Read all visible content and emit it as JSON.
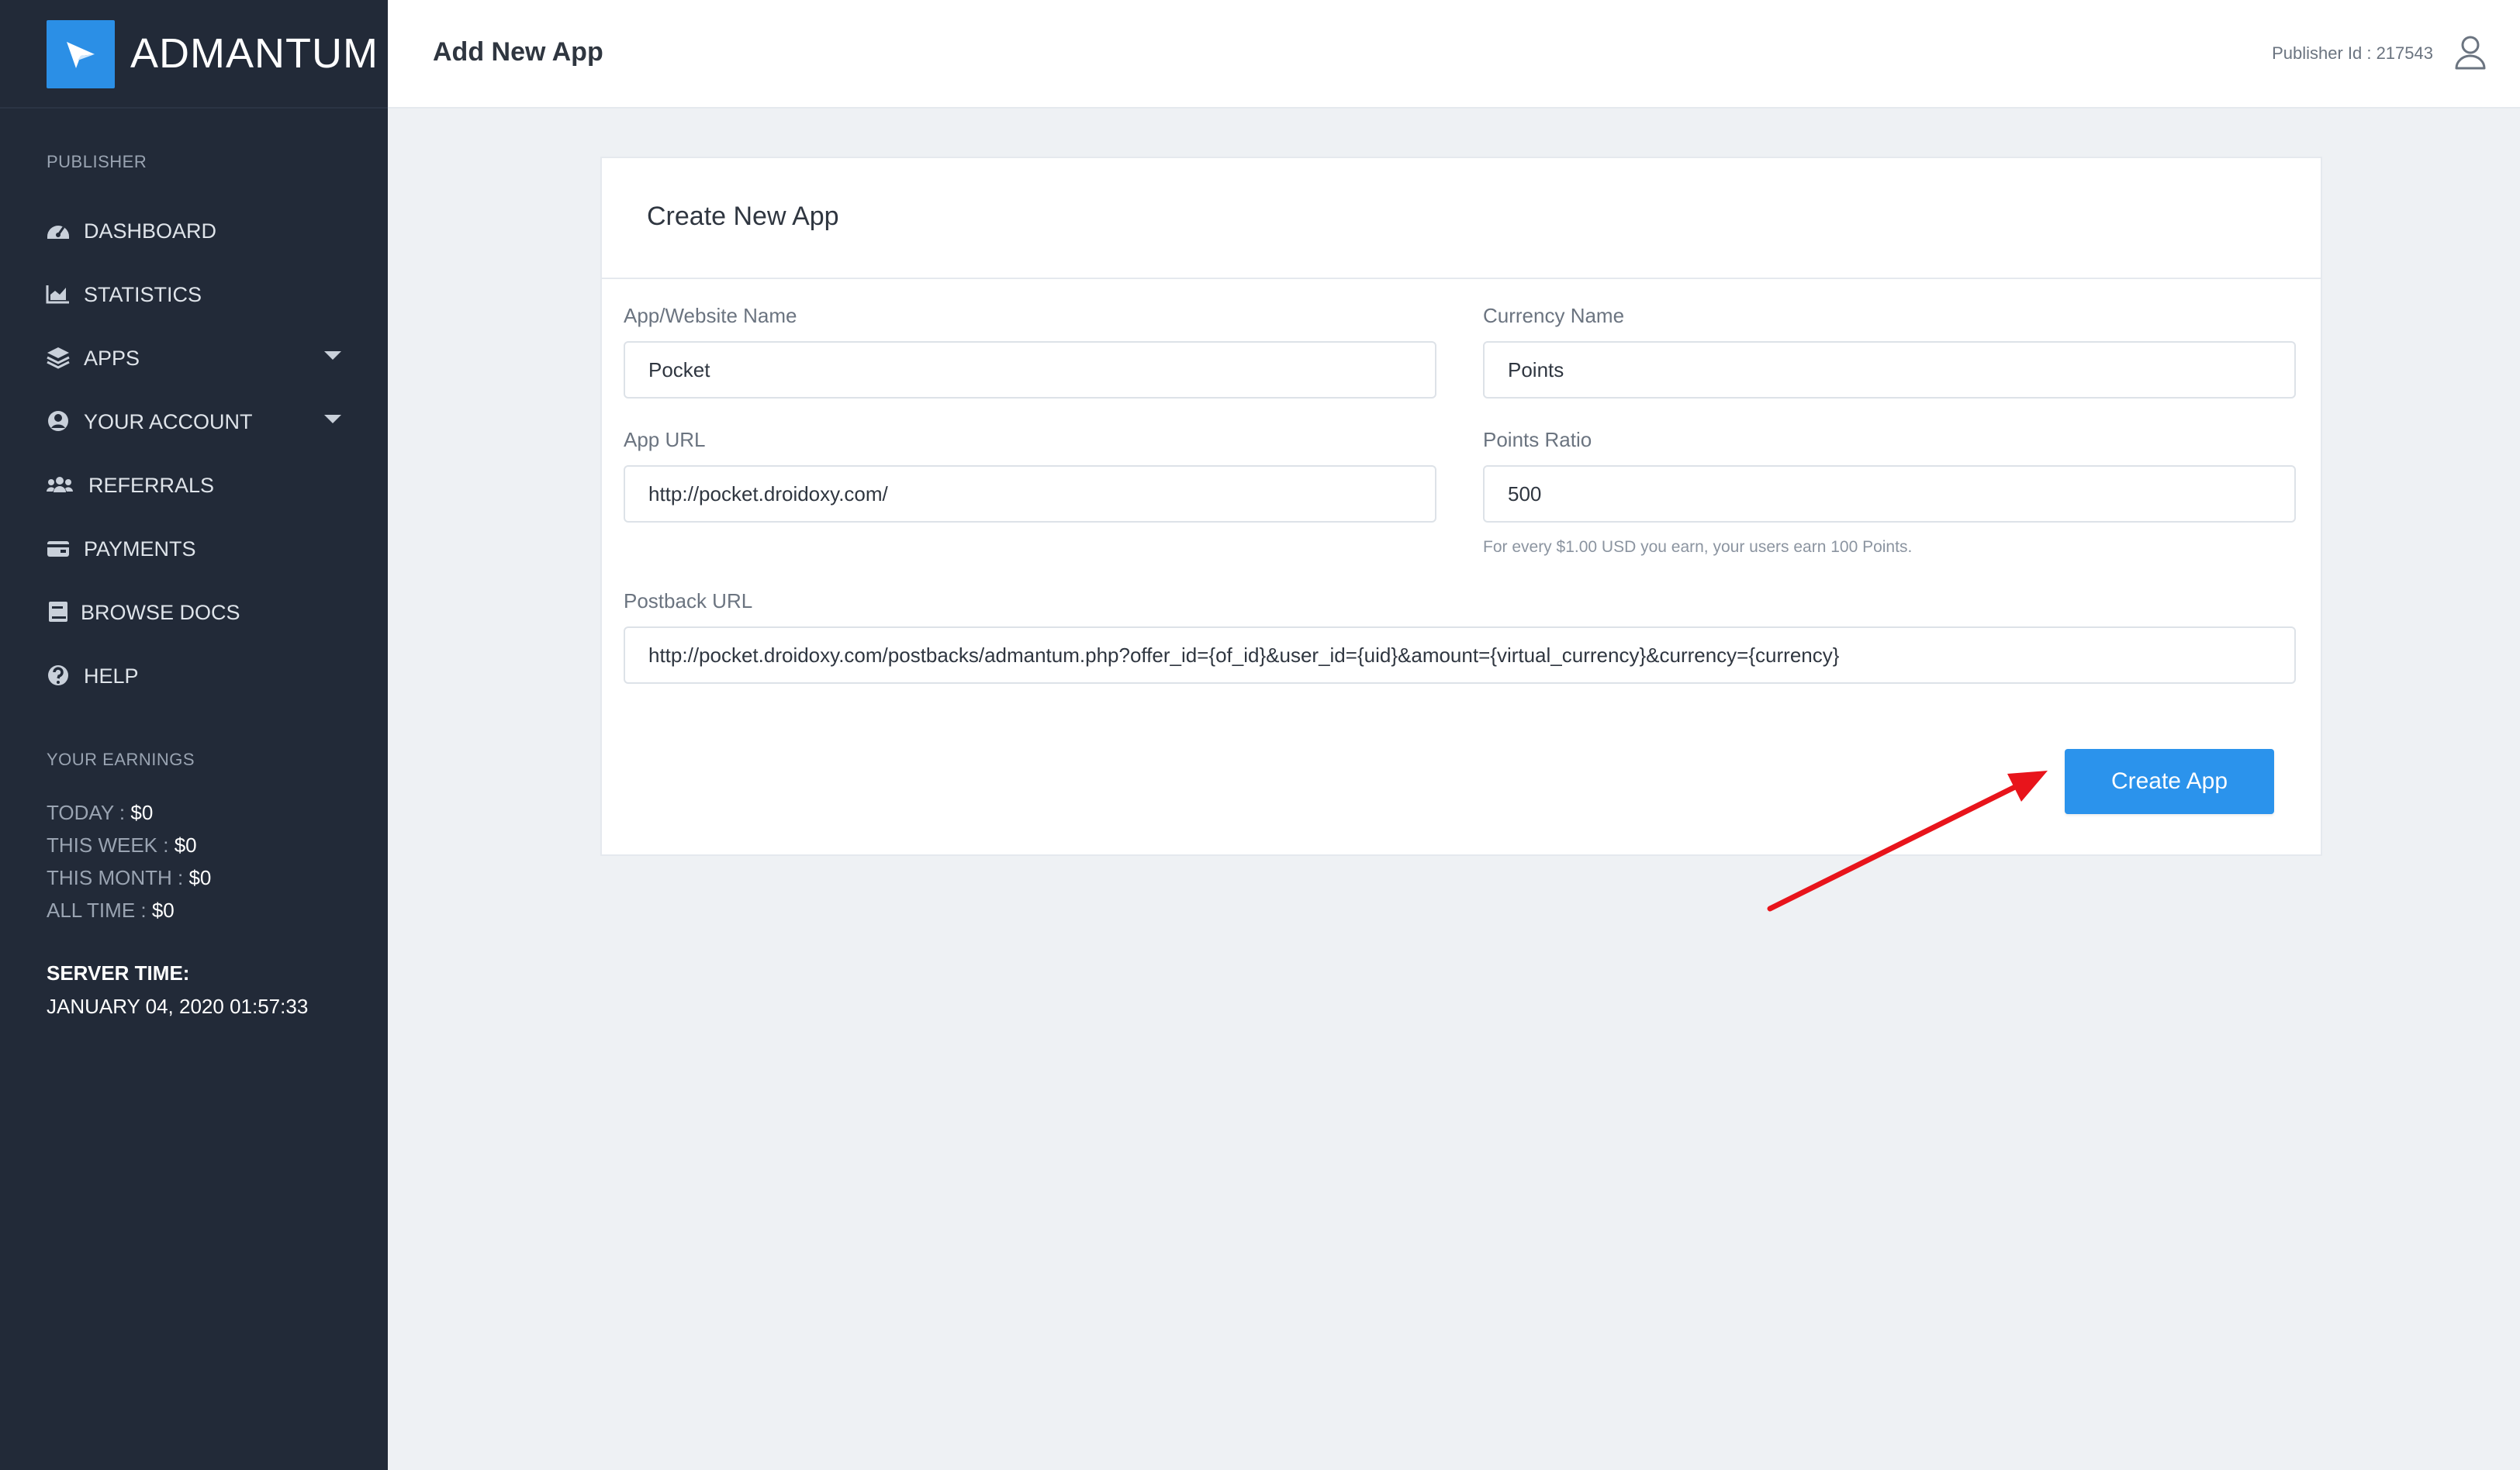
{
  "brand": {
    "name": "ADMANTUM"
  },
  "header": {
    "page_title": "Add New App",
    "publisher_id": "Publisher Id : 217543"
  },
  "sidebar": {
    "section_label": "PUBLISHER",
    "items": [
      {
        "label": "DASHBOARD",
        "icon": "dashboard-icon"
      },
      {
        "label": "STATISTICS",
        "icon": "chart-icon"
      },
      {
        "label": "APPS",
        "icon": "layers-icon",
        "has_caret": true
      },
      {
        "label": "YOUR ACCOUNT",
        "icon": "user-circle-icon",
        "has_caret": true
      },
      {
        "label": "REFERRALS",
        "icon": "users-icon"
      },
      {
        "label": "PAYMENTS",
        "icon": "wallet-icon"
      },
      {
        "label": "BROWSE DOCS",
        "icon": "book-icon"
      },
      {
        "label": "HELP",
        "icon": "question-icon"
      }
    ],
    "earnings_label": "YOUR EARNINGS",
    "earnings": [
      {
        "label": "TODAY : ",
        "value": "$0"
      },
      {
        "label": "THIS WEEK : ",
        "value": "$0"
      },
      {
        "label": "THIS MONTH : ",
        "value": "$0"
      },
      {
        "label": "ALL TIME : ",
        "value": "$0"
      }
    ],
    "server_time_label": "SERVER TIME:",
    "server_time": "JANUARY 04, 2020 01:57:33"
  },
  "form": {
    "title": "Create New App",
    "app_name_label": "App/Website Name",
    "app_name_value": "Pocket",
    "currency_name_label": "Currency Name",
    "currency_name_value": "Points",
    "app_url_label": "App URL",
    "app_url_value": "http://pocket.droidoxy.com/",
    "points_ratio_label": "Points Ratio",
    "points_ratio_value": "500",
    "points_ratio_help": "For every $1.00 USD you earn, your users earn 100 Points.",
    "postback_label": "Postback URL",
    "postback_value": "http://pocket.droidoxy.com/postbacks/admantum.php?offer_id={of_id}&user_id={uid}&amount={virtual_currency}&currency={currency}",
    "submit_label": "Create App"
  },
  "colors": {
    "sidebar_bg": "#222a38",
    "accent": "#2b93ec",
    "annotation_arrow": "#e8141b"
  }
}
